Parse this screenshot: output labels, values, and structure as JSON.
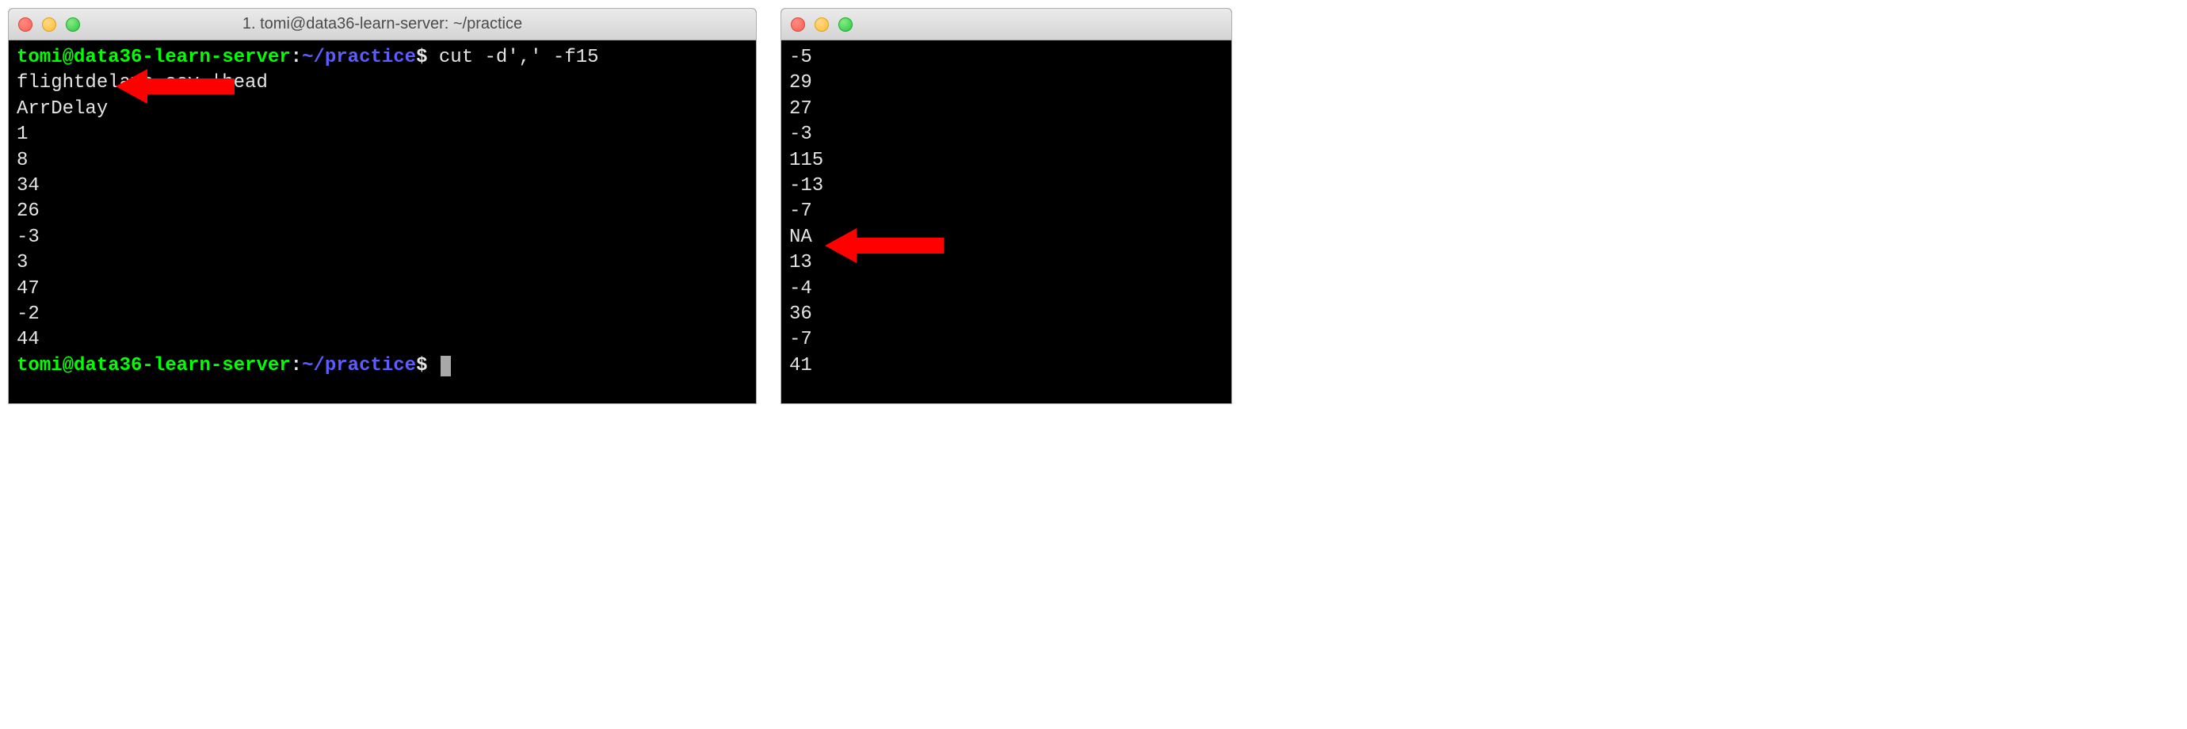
{
  "left_window": {
    "title": "1. tomi@data36-learn-server: ~/practice",
    "prompt": {
      "user_host": "tomi@data36-learn-server",
      "colon": ":",
      "path": "~/practice",
      "dollar": "$"
    },
    "command": " cut -d',' -f15 flightdelays.csv |head",
    "output": [
      "ArrDelay",
      "1",
      "8",
      "34",
      "26",
      "-3",
      "3",
      "47",
      "-2",
      "44"
    ]
  },
  "right_window": {
    "output": [
      "-5",
      "29",
      "27",
      "-3",
      "115",
      "-13",
      "-7",
      "NA",
      "13",
      "-4",
      "36",
      "-7",
      "41"
    ]
  },
  "annotations": {
    "arrow_color": "#ff0000"
  }
}
